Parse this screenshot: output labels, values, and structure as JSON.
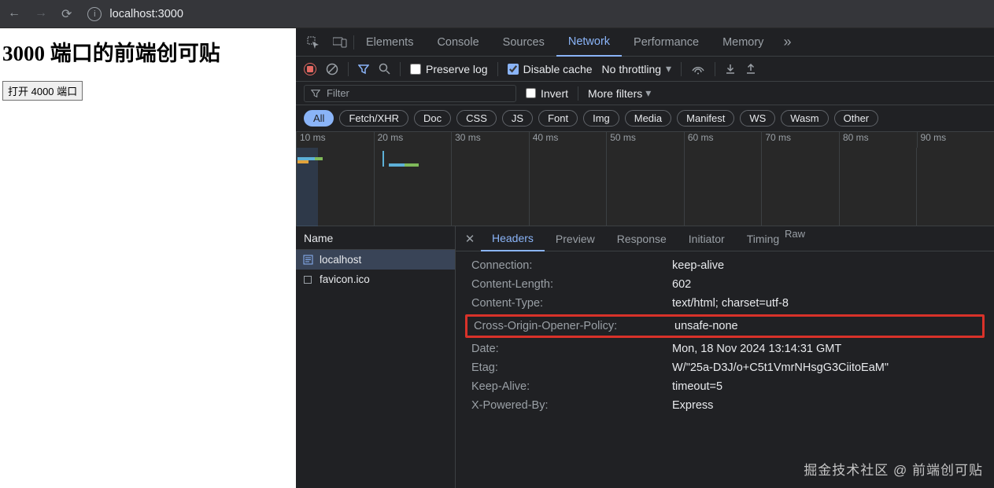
{
  "browser": {
    "url": "localhost:3000"
  },
  "page": {
    "heading": "3000 端口的前端创可贴",
    "button": "打开 4000 端口"
  },
  "devtools": {
    "tabs": [
      "Elements",
      "Console",
      "Sources",
      "Network",
      "Performance",
      "Memory"
    ],
    "active_tab": "Network",
    "toolbar": {
      "preserve_log": "Preserve log",
      "disable_cache": "Disable cache",
      "throttling": "No throttling"
    },
    "filter": {
      "placeholder": "Filter",
      "invert": "Invert",
      "more_filters": "More filters"
    },
    "chips": [
      "All",
      "Fetch/XHR",
      "Doc",
      "CSS",
      "JS",
      "Font",
      "Img",
      "Media",
      "Manifest",
      "WS",
      "Wasm",
      "Other"
    ],
    "active_chip": "All",
    "timeline_labels": [
      "10 ms",
      "20 ms",
      "30 ms",
      "40 ms",
      "50 ms",
      "60 ms",
      "70 ms",
      "80 ms",
      "90 ms"
    ],
    "requests": {
      "column_name": "Name",
      "items": [
        {
          "name": "localhost",
          "selected": true,
          "icon": "doc"
        },
        {
          "name": "favicon.ico",
          "selected": false,
          "icon": "file"
        }
      ]
    },
    "detail_tabs": [
      "Headers",
      "Preview",
      "Response",
      "Initiator",
      "Timing"
    ],
    "active_detail_tab": "Headers",
    "raw_label": "Raw",
    "headers": [
      {
        "k": "Connection:",
        "v": "keep-alive"
      },
      {
        "k": "Content-Length:",
        "v": "602"
      },
      {
        "k": "Content-Type:",
        "v": "text/html; charset=utf-8"
      },
      {
        "k": "Cross-Origin-Opener-Policy:",
        "v": "unsafe-none",
        "highlight": true
      },
      {
        "k": "Date:",
        "v": "Mon, 18 Nov 2024 13:14:31 GMT"
      },
      {
        "k": "Etag:",
        "v": "W/\"25a-D3J/o+C5t1VmrNHsgG3CiitoEaM\""
      },
      {
        "k": "Keep-Alive:",
        "v": "timeout=5"
      },
      {
        "k": "X-Powered-By:",
        "v": "Express"
      }
    ]
  },
  "watermark": "掘金技术社区 @ 前端创可贴"
}
